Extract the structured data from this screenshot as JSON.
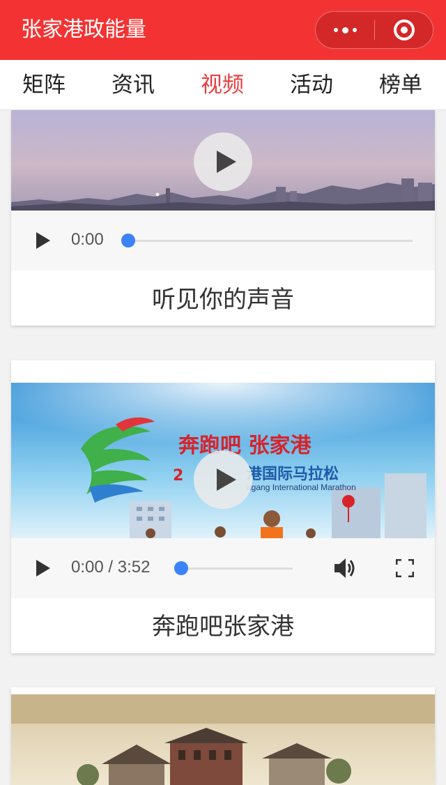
{
  "app": {
    "title": "张家港政能量"
  },
  "tabs": [
    {
      "label": "矩阵"
    },
    {
      "label": "资讯"
    },
    {
      "label": "视频",
      "active": true
    },
    {
      "label": "活动"
    },
    {
      "label": "榜单"
    }
  ],
  "colors": {
    "brand_red": "#f33333",
    "active_tab": "#e83b3b",
    "progress_knob": "#3b82f6"
  },
  "videos": [
    {
      "caption": "听见你的声音",
      "time": "0:00",
      "progress": 0
    },
    {
      "caption": "奔跑吧张家港",
      "time": "0:00 / 3:52",
      "progress": 0,
      "thumb_text": {
        "headline": "奔跑吧 张家港",
        "subtitle": "港国际马拉松",
        "english": "agang International Marathon",
        "year_fragment": "2"
      }
    },
    {
      "caption": "",
      "progress": 0
    }
  ],
  "icons": {
    "play": "play-icon",
    "volume": "volume-icon",
    "fullscreen": "fullscreen-icon",
    "more": "more-dots-icon",
    "close": "target-close-icon"
  }
}
